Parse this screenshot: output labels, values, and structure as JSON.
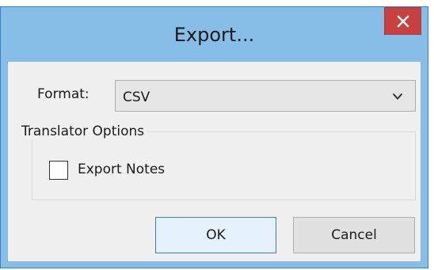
{
  "dialog": {
    "title": "Export...",
    "close_icon": "close-icon"
  },
  "format": {
    "label": "Format:",
    "selected": "CSV",
    "dropdown_icon": "chevron-down-icon"
  },
  "translator_options": {
    "title": "Translator Options",
    "export_notes": {
      "label": "Export Notes",
      "checked": false
    }
  },
  "buttons": {
    "ok_label": "OK",
    "cancel_label": "Cancel"
  },
  "colors": {
    "title_bar": "#87bee8",
    "close_button": "#c94040",
    "client_area": "#f0f0f0",
    "default_button_border": "#3c7fb1"
  }
}
